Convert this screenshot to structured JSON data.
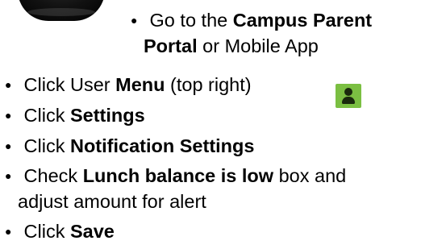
{
  "portal_line": {
    "bullet": "●",
    "pre": "Go to the",
    "bold": "Campus Parent",
    "bold2": "Portal",
    "post": "or Mobile App"
  },
  "steps": [
    {
      "bullet": "●",
      "pre": "Click User",
      "bold": "Menu",
      "post": "(top right)"
    },
    {
      "bullet": "●",
      "pre": "Click",
      "bold": "Settings",
      "post": ""
    },
    {
      "bullet": "●",
      "pre": "Click",
      "bold": "Notification Settings",
      "post": ""
    },
    {
      "bullet": "●",
      "pre": "Check",
      "bold": "Lunch balance is low",
      "post": "box and",
      "post2": "adjust amount for alert"
    },
    {
      "bullet": "●",
      "pre": "Click",
      "bold": "Save",
      "post": ""
    }
  ],
  "icons": {
    "user_menu": "user-icon",
    "phone": "phone-corner",
    "accent": "#7bbf42"
  }
}
